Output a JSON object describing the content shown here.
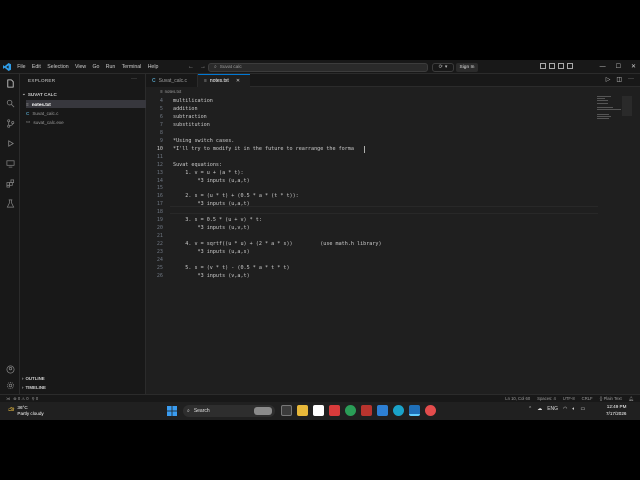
{
  "titlebar": {
    "menu": [
      "File",
      "Edit",
      "Selection",
      "View",
      "Go",
      "Run",
      "Terminal",
      "Help"
    ],
    "search": "Suvat calc",
    "signin": "Sign In"
  },
  "sidebar": {
    "header": "EXPLORER",
    "folder": "SUVAT CALC",
    "files": [
      {
        "name": "notes.txt",
        "icon": "text-file-icon"
      },
      {
        "name": "Suvat_calc.c",
        "icon": "c-file-icon"
      },
      {
        "name": "suvat_calc.exe",
        "icon": "exe-file-icon"
      }
    ],
    "outline": "OUTLINE",
    "timeline": "TIMELINE"
  },
  "tabs": [
    {
      "label": "Suvat_calc.c",
      "active": false
    },
    {
      "label": "notes.txt",
      "active": true
    }
  ],
  "breadcrumb": "notes.txt",
  "editor": {
    "lines": [
      {
        "n": "4",
        "text": "multilication"
      },
      {
        "n": "5",
        "text": "addition"
      },
      {
        "n": "6",
        "text": "subtraction"
      },
      {
        "n": "7",
        "text": "substitution"
      },
      {
        "n": "8",
        "text": ""
      },
      {
        "n": "9",
        "text": "*Using switch cases."
      },
      {
        "n": "10",
        "text": "*I'll try to modify it in the future to rearrange the forma"
      },
      {
        "n": "11",
        "text": ""
      },
      {
        "n": "12",
        "text": "Suvat equations:"
      },
      {
        "n": "13",
        "text": "    1. v = u + (a * t):"
      },
      {
        "n": "14",
        "text": "        *3 inputs (u,a,t)"
      },
      {
        "n": "15",
        "text": ""
      },
      {
        "n": "16",
        "text": "    2. s = (u * t) + (0.5 * a * (t * t)):"
      },
      {
        "n": "17",
        "text": "        *3 inputs (u,a,t)"
      },
      {
        "n": "18",
        "text": ""
      },
      {
        "n": "19",
        "text": "    3. s = 0.5 * (u + v) * t:"
      },
      {
        "n": "20",
        "text": "        *3 inputs (u,v,t)"
      },
      {
        "n": "21",
        "text": ""
      },
      {
        "n": "22",
        "text": "    4. v = sqrtf((u * u) + (2 * a * s))         (use math.h library)"
      },
      {
        "n": "23",
        "text": "        *3 inputs (u,a,s)"
      },
      {
        "n": "24",
        "text": ""
      },
      {
        "n": "25",
        "text": "    5. s = (v * t) - (0.5 * a * t * t)"
      },
      {
        "n": "26",
        "text": "        *3 inputs (v,a,t)"
      }
    ]
  },
  "statusbar": {
    "problems": "⊗ 0 ⚠ 0",
    "ports": "0",
    "position": "Ln 10, Col 60",
    "spaces": "Spaces: 4",
    "encoding": "UTF-8",
    "eol": "CRLF",
    "language": "Plain Text"
  },
  "taskbar": {
    "temp": "36°C",
    "weather": "Partly cloudy",
    "search": "Search",
    "lang": "ENG",
    "time": "12:49 PM",
    "date": "7/17/2026"
  },
  "colors": {
    "accent": "#0078d4",
    "editor_bg": "#1f1f1f",
    "chrome_bg": "#181818",
    "taskbar_bg": "#202020"
  }
}
